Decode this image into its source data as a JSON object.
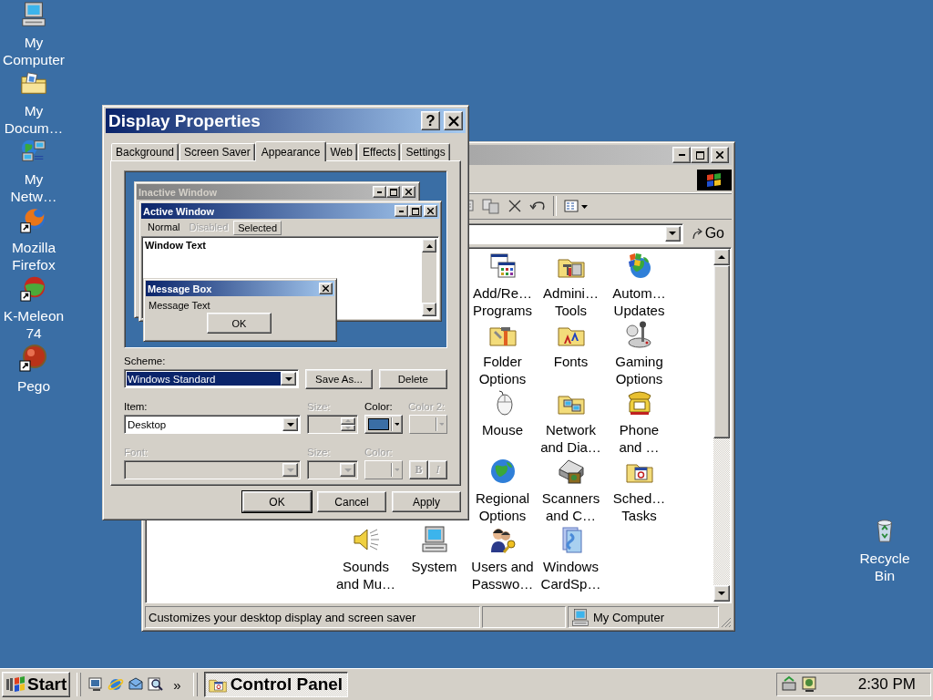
{
  "desktop_icons": [
    {
      "label": "My\nComputer"
    },
    {
      "label": "My\nDocum…"
    },
    {
      "label": "My\nNetw…"
    },
    {
      "label": "Mozilla\nFirefox"
    },
    {
      "label": "K-Meleon\n74"
    },
    {
      "label": "Pego"
    }
  ],
  "recycle_bin": {
    "label": "Recycle\nBin"
  },
  "control_panel": {
    "go": "Go",
    "icon_rows": [
      [
        {
          "label": "Add/Re…\nPrograms"
        },
        {
          "label": "Admini…\nTools"
        },
        {
          "label": "Autom…\nUpdates"
        }
      ],
      [
        {
          "label": "Folder\nOptions"
        },
        {
          "label": "Fonts"
        },
        {
          "label": "Gaming\nOptions"
        }
      ],
      [
        {
          "label": "Mouse"
        },
        {
          "label": "Network\nand Dia…"
        },
        {
          "label": "Phone\nand …"
        }
      ],
      [
        {
          "label": "Regional\nOptions"
        },
        {
          "label": "Scanners\nand C…"
        },
        {
          "label": "Sched…\nTasks"
        }
      ],
      [
        {
          "label": "Sounds\nand Mu…"
        },
        {
          "label": "System"
        },
        {
          "label": "Users and\nPasswo…"
        },
        {
          "label": "Windows\nCardSp…"
        }
      ]
    ],
    "status_text": "Customizes your desktop display and screen saver",
    "status_location": "My Computer"
  },
  "dialog": {
    "title": "Display Properties",
    "help": "?",
    "tabs": [
      {
        "label": "Background",
        "selected": false
      },
      {
        "label": "Screen Saver",
        "selected": false
      },
      {
        "label": "Appearance",
        "selected": true
      },
      {
        "label": "Web",
        "selected": false
      },
      {
        "label": "Effects",
        "selected": false
      },
      {
        "label": "Settings",
        "selected": false
      }
    ],
    "preview": {
      "inactive_title": "Inactive Window",
      "active_title": "Active Window",
      "menu": [
        {
          "label": "Normal",
          "kind": "normal"
        },
        {
          "label": "Disabled",
          "kind": "disabled"
        },
        {
          "label": "Selected",
          "kind": "selected"
        }
      ],
      "window_text": "Window Text",
      "message_title": "Message Box",
      "message_text": "Message Text",
      "ok": "OK"
    },
    "scheme": {
      "label": "Scheme:",
      "value": "Windows Standard"
    },
    "save_as": "Save As...",
    "delete": "Delete",
    "item": {
      "label": "Item:",
      "value": "Desktop"
    },
    "item_size": {
      "label": "Size:",
      "disabled": true
    },
    "item_color": {
      "label": "Color:",
      "disabled": false,
      "color": "#3a6ea5"
    },
    "item_color2": {
      "label": "Color 2:",
      "disabled": true
    },
    "font": {
      "label": "Font:",
      "disabled": true
    },
    "font_size": {
      "label": "Size:",
      "disabled": true
    },
    "font_color": {
      "label": "Color:",
      "disabled": true
    },
    "bold": {
      "label": "B",
      "disabled": true
    },
    "italic": {
      "label": "I",
      "disabled": true
    },
    "buttons": [
      {
        "label": "OK",
        "default": true
      },
      {
        "label": "Cancel",
        "default": false
      },
      {
        "label": "Apply",
        "default": false
      }
    ]
  },
  "taskbar": {
    "start": "Start",
    "more": "»",
    "tasks": [
      {
        "label": "Control Panel",
        "selected": true
      }
    ],
    "clock": "2:30 PM"
  }
}
